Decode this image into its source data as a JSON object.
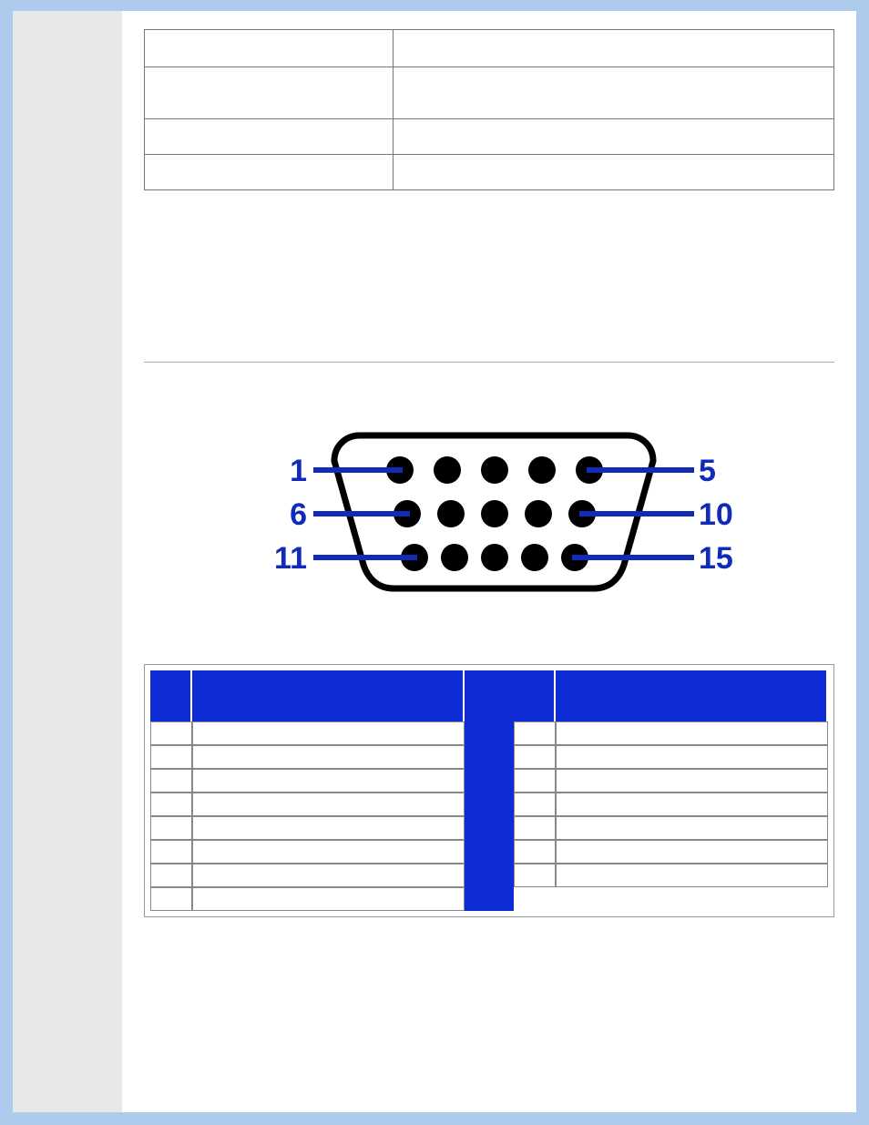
{
  "top_table": {
    "rows": [
      {
        "c1": "",
        "c2": ""
      },
      {
        "c1": "",
        "c2": ""
      },
      {
        "c1": "",
        "c2": ""
      },
      {
        "c1": "",
        "c2": ""
      }
    ]
  },
  "connector": {
    "labels": {
      "left_top": "1",
      "left_mid": "6",
      "left_bot": "11",
      "right_top": "5",
      "right_mid": "10",
      "right_bot": "15"
    }
  },
  "pin_table": {
    "headers": {
      "left_no": "",
      "left_side": "",
      "right_no": "",
      "right_side": ""
    },
    "left": [
      {
        "no": "",
        "side": ""
      },
      {
        "no": "",
        "side": ""
      },
      {
        "no": "",
        "side": ""
      },
      {
        "no": "",
        "side": ""
      },
      {
        "no": "",
        "side": ""
      },
      {
        "no": "",
        "side": ""
      },
      {
        "no": "",
        "side": ""
      },
      {
        "no": "",
        "side": ""
      }
    ],
    "right": [
      {
        "no": "",
        "side": ""
      },
      {
        "no": "",
        "side": ""
      },
      {
        "no": "",
        "side": ""
      },
      {
        "no": "",
        "side": ""
      },
      {
        "no": "",
        "side": ""
      },
      {
        "no": "",
        "side": ""
      },
      {
        "no": "",
        "side": ""
      }
    ]
  }
}
